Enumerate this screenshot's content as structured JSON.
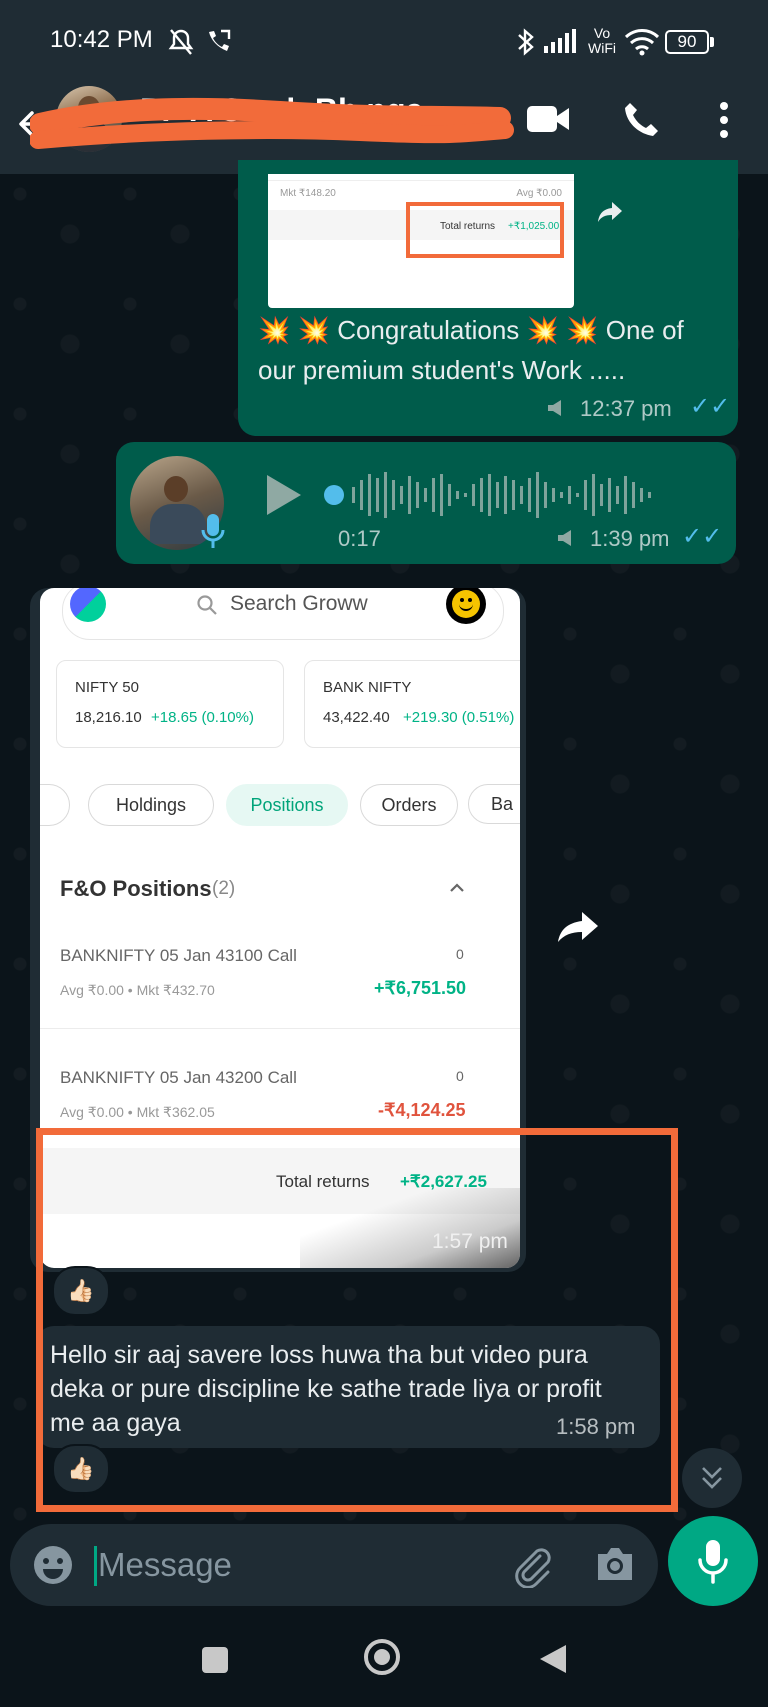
{
  "status_bar": {
    "time": "10:42 PM",
    "battery": "90",
    "network_label": "Vo WiFi"
  },
  "header": {
    "contact_name": "PP A S.....h Bh.nga...",
    "icons": [
      "back-arrow-icon",
      "video-call-icon",
      "phone-icon",
      "more-vertical-icon"
    ]
  },
  "messages": {
    "msg1": {
      "preview": {
        "mkt": "Mkt ₹148.20",
        "avg": "Avg ₹0.00",
        "total_label": "Total returns",
        "total_value": "+₹1,025.00"
      },
      "text": "💥 💥 Congratulations 💥 💥 One of our premium student's Work .....",
      "time": "12:37 pm"
    },
    "voice": {
      "duration": "0:17",
      "time": "1:39 pm"
    },
    "screenshot": {
      "search_placeholder": "Search Groww",
      "indices": [
        {
          "name": "NIFTY 50",
          "value": "18,216.10",
          "change": "+18.65 (0.10%)"
        },
        {
          "name": "BANK NIFTY",
          "value": "43,422.40",
          "change": "+219.30 (0.51%)"
        }
      ],
      "tabs": [
        "Holdings",
        "Positions",
        "Orders",
        "Ba"
      ],
      "section_title": "F&O Positions",
      "section_count": "(2)",
      "positions": [
        {
          "name": "BANKNIFTY 05 Jan 43100 Call",
          "qty": "0",
          "meta": "Avg ₹0.00 • Mkt ₹432.70",
          "pnl": "+₹6,751.50"
        },
        {
          "name": "BANKNIFTY 05 Jan 43200 Call",
          "qty": "0",
          "meta": "Avg ₹0.00 • Mkt ₹362.05",
          "pnl": "-₹4,124.25"
        }
      ],
      "total_label": "Total returns",
      "total_value": "+₹2,627.25",
      "time": "1:57 pm",
      "reaction": "👍🏻"
    },
    "text_msg": {
      "text": "Hello sir aaj savere loss huwa tha but video pura deka or pure discipline ke sathe trade liya or profit me aa gaya",
      "time": "1:58 pm",
      "reaction": "👍🏻"
    }
  },
  "composer": {
    "placeholder": "Message"
  },
  "colors": {
    "outgoing_bubble": "#005c4b",
    "incoming_bubble": "#1f2c34",
    "accent": "#00a884",
    "highlight": "#f26b3a",
    "gain": "#00b386",
    "loss": "#e0533d"
  }
}
